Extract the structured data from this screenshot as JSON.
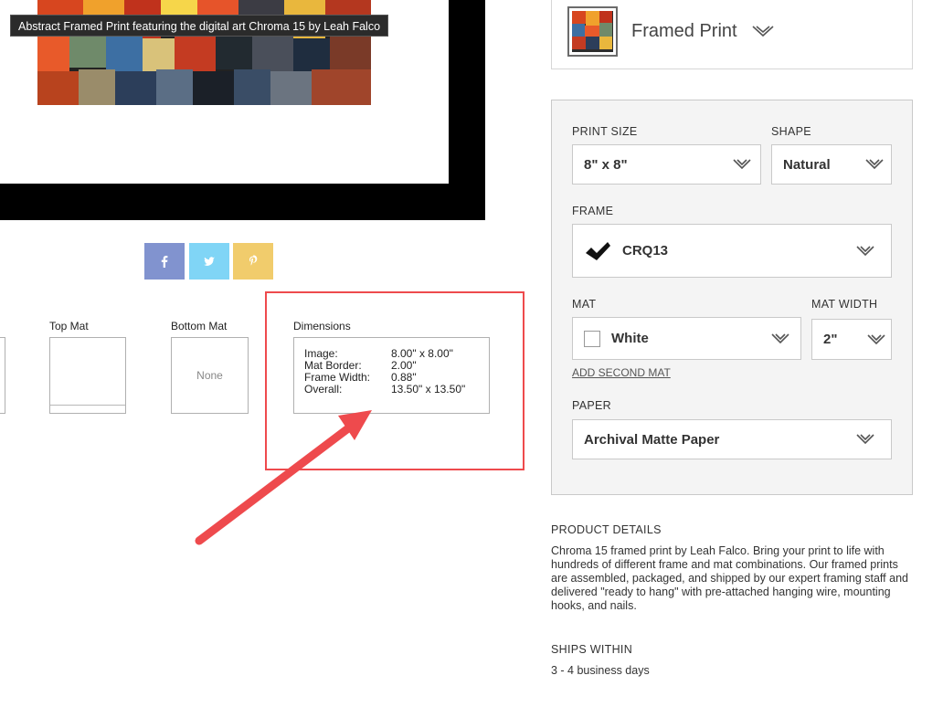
{
  "artwork": {
    "tooltip": "Abstract Framed Print featuring the digital art Chroma 15 by Leah Falco"
  },
  "share": {
    "facebook_icon": "facebook-icon",
    "twitter_icon": "twitter-icon",
    "pinterest_icon": "pinterest-icon",
    "colors": {
      "facebook": "#8193cf",
      "twitter": "#80d5f6",
      "pinterest": "#f1cc6c"
    }
  },
  "options": {
    "top_mat_label": "Top Mat",
    "bottom_mat_label": "Bottom Mat",
    "bottom_mat_value": "None",
    "dimensions_label": "Dimensions",
    "dimensions": [
      {
        "key": "Image:",
        "value": "8.00\" x 8.00\""
      },
      {
        "key": "Mat Border:",
        "value": "2.00\""
      },
      {
        "key": "Frame Width:",
        "value": "0.88\""
      },
      {
        "key": "Overall:",
        "value": "13.50\" x 13.50\""
      }
    ],
    "highlight_color": "#ee4a4d"
  },
  "product": {
    "title": "Framed Print"
  },
  "config": {
    "print_size": {
      "label": "PRINT SIZE",
      "value": "8\" x 8\""
    },
    "shape": {
      "label": "SHAPE",
      "value": "Natural"
    },
    "frame": {
      "label": "FRAME",
      "value": "CRQ13"
    },
    "mat": {
      "label": "MAT",
      "value": "White"
    },
    "mat_width": {
      "label": "MAT WIDTH",
      "value": "2\""
    },
    "add_second_mat": "ADD SECOND MAT",
    "paper": {
      "label": "PAPER",
      "value": "Archival Matte Paper"
    }
  },
  "details": {
    "title": "PRODUCT DETAILS",
    "text": "Chroma 15 framed print by Leah Falco.   Bring your print to life with hundreds of different frame and mat combinations. Our framed prints are assembled, packaged, and shipped by our expert framing staff and delivered \"ready to hang\" with pre-attached hanging wire, mounting hooks, and nails."
  },
  "shipping": {
    "title": "SHIPS WITHIN",
    "value": "3 - 4 business days"
  }
}
